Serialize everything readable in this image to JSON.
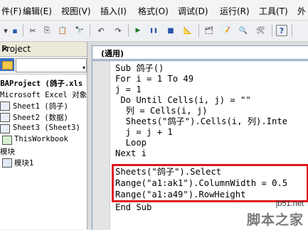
{
  "menu": {
    "items": [
      "件(F)",
      "编辑(E)",
      "视图(V)",
      "插入(I)",
      "格式(O)",
      "调试(D)",
      "运行(R)",
      "工具(T)",
      "外"
    ]
  },
  "toolbar": {
    "icons": [
      "menu-arrow-icon",
      "save-icon",
      "cut-icon",
      "copy-icon",
      "paste-icon",
      "find-icon",
      "undo-icon",
      "redo-icon",
      "run-icon",
      "break-icon",
      "reset-icon",
      "design-mode-icon",
      "project-explorer-icon",
      "properties-icon",
      "object-browser-icon",
      "toolbox-icon",
      "help-icon"
    ],
    "glyphs": [
      "▾",
      "▪",
      "✂",
      "⎘",
      "📋",
      "🔭",
      "↶",
      "↷",
      "▶",
      "❚❚",
      "■",
      "📐",
      "🗂",
      "📝",
      "🔍",
      "🛠",
      "?"
    ]
  },
  "project": {
    "title": "Project",
    "close": "✕",
    "tree": [
      "VBAProject (鸽子.xls",
      "Microsoft Excel 对象",
      "Sheet1 (鸽子)",
      "Sheet2 (数据)",
      "Sheet3 (Sheet3)",
      "ThisWorkbook",
      "模块",
      "模块1"
    ]
  },
  "editor": {
    "object_combo": "(通用)",
    "lines": [
      "Sub 鸽子()",
      "For i = 1 To 49",
      "j = 1",
      " Do Until Cells(i, j) = \"\"",
      "  列 = Cells(i, j)",
      "  Sheets(\"鸽子\").Cells(i, 列).Inte",
      "  j = j + 1",
      "  Loop",
      "Next i",
      "Sheets(\"鸽子\").Select",
      "Range(\"a1:ak1\").ColumnWidth = 0.5",
      "Range(\"a1:a49\").RowHeight",
      "End Sub"
    ]
  },
  "watermark": {
    "url": "jb51.net",
    "text": "脚本之家"
  },
  "colors": {
    "highlight": "#e0151f"
  }
}
